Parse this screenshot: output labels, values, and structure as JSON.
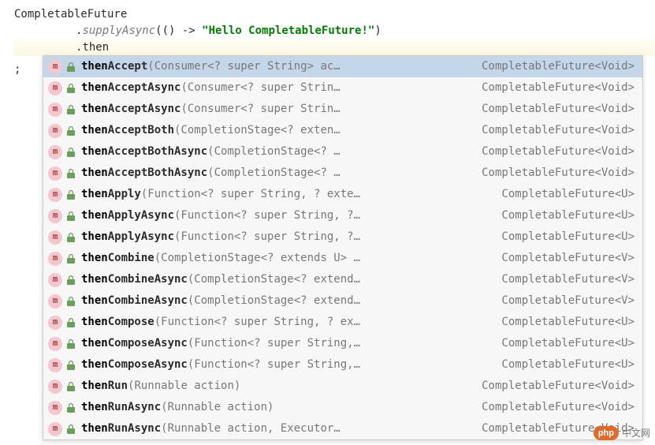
{
  "code": {
    "line1": "CompletableFuture",
    "line2_prefix": ".",
    "line2_method": "supplyAsync",
    "line2_params_open": "(() -> ",
    "line2_string": "\"Hello CompletableFuture!\"",
    "line2_params_close": ")",
    "line3_prefix": ".",
    "line3_typed": "then",
    "gutter_semi": ";"
  },
  "completion": {
    "icon_letter": "m",
    "match_prefix": "then",
    "items": [
      {
        "suffix": "Accept",
        "params": "(Consumer<? super String> ac…",
        "ret": "CompletableFuture<Void>",
        "selected": true
      },
      {
        "suffix": "AcceptAsync",
        "params": "(Consumer<? super Strin…",
        "ret": "CompletableFuture<Void>"
      },
      {
        "suffix": "AcceptAsync",
        "params": "(Consumer<? super Strin…",
        "ret": "CompletableFuture<Void>"
      },
      {
        "suffix": "AcceptBoth",
        "params": "(CompletionStage<? exten…",
        "ret": "CompletableFuture<Void>"
      },
      {
        "suffix": "AcceptBothAsync",
        "params": "(CompletionStage<? …",
        "ret": "CompletableFuture<Void>"
      },
      {
        "suffix": "AcceptBothAsync",
        "params": "(CompletionStage<? …",
        "ret": "CompletableFuture<Void>"
      },
      {
        "suffix": "Apply",
        "params": "(Function<? super String, ? exte…",
        "ret": "CompletableFuture<U>"
      },
      {
        "suffix": "ApplyAsync",
        "params": "(Function<? super String, ?…",
        "ret": "CompletableFuture<U>"
      },
      {
        "suffix": "ApplyAsync",
        "params": "(Function<? super String, ?…",
        "ret": "CompletableFuture<U>"
      },
      {
        "suffix": "Combine",
        "params": "(CompletionStage<? extends U> …",
        "ret": "CompletableFuture<V>"
      },
      {
        "suffix": "CombineAsync",
        "params": "(CompletionStage<? extend…",
        "ret": "CompletableFuture<V>"
      },
      {
        "suffix": "CombineAsync",
        "params": "(CompletionStage<? extend…",
        "ret": "CompletableFuture<V>"
      },
      {
        "suffix": "Compose",
        "params": "(Function<? super String, ? ex…",
        "ret": "CompletableFuture<U>"
      },
      {
        "suffix": "ComposeAsync",
        "params": "(Function<? super String,…",
        "ret": "CompletableFuture<U>"
      },
      {
        "suffix": "ComposeAsync",
        "params": "(Function<? super String,…",
        "ret": "CompletableFuture<U>"
      },
      {
        "suffix": "Run",
        "params": "(Runnable action)",
        "ret": "CompletableFuture<Void>"
      },
      {
        "suffix": "RunAsync",
        "params": "(Runnable action)",
        "ret": "CompletableFuture<Void>"
      },
      {
        "suffix": "RunAsync",
        "params": "(Runnable action, Executor…",
        "ret": "CompletableFuture<Void>"
      }
    ]
  },
  "watermark": {
    "php": "php",
    "cn": "中文网"
  }
}
